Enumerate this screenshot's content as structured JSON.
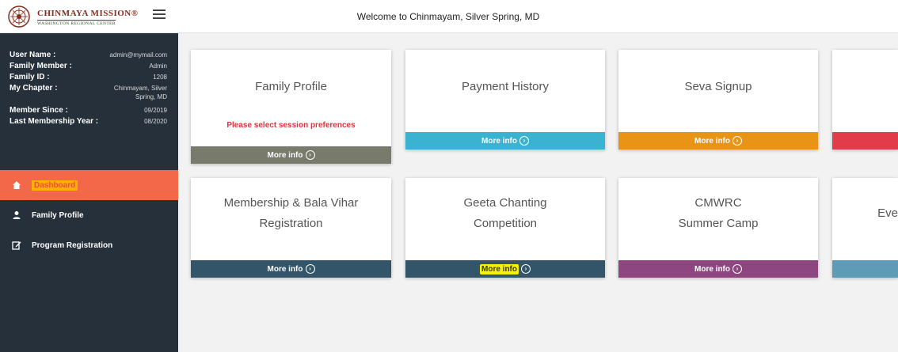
{
  "header": {
    "logo_name": "CHINMAYA MISSION®",
    "logo_sub": "WASHINGTON REGIONAL CENTER",
    "welcome": "Welcome to Chinmayam, Silver Spring, MD"
  },
  "profile": {
    "rows": [
      {
        "label": "User Name :",
        "value": "admin@mymail.com"
      },
      {
        "label": "Family Member :",
        "value": "Admin"
      },
      {
        "label": "Family ID :",
        "value": "1208"
      },
      {
        "label": "My Chapter :",
        "value": "Chinmayam, Silver Spring, MD"
      },
      {
        "label": "Member Since :",
        "value": "09/2019"
      },
      {
        "label": "Last Membership Year :",
        "value": "08/2020"
      }
    ]
  },
  "nav": [
    {
      "label": "Dashboard",
      "icon": "home-icon"
    },
    {
      "label": "Family Profile",
      "icon": "user-icon"
    },
    {
      "label": "Program Registration",
      "icon": "edit-icon"
    }
  ],
  "cards": [
    {
      "title": "Family Profile",
      "warning": "Please select session preferences",
      "footer": "More info",
      "color": "#787a6c"
    },
    {
      "title": "Payment History",
      "footer": "More info",
      "color": "#3ab3d0"
    },
    {
      "title": "Seva Signup",
      "footer": "More info",
      "color": "#ea9415"
    },
    {
      "title": "",
      "footer": "",
      "color": "#e23b4a"
    },
    {
      "title_line1": "Membership & Bala Vihar",
      "title_line2": "Registration",
      "footer": "More info",
      "color": "#33556a"
    },
    {
      "title_line1": "Geeta Chanting",
      "title_line2": "Competition",
      "footer": "More info",
      "color": "#33556a"
    },
    {
      "title_line1": "CMWRC",
      "title_line2": "Summer Camp",
      "footer": "More info",
      "color": "#8e4680"
    },
    {
      "title_line1": "Eve",
      "footer": "",
      "color": "#5f9ab6"
    }
  ],
  "colors": {
    "sidebar": "#26303a",
    "active_nav": "#f26848"
  }
}
